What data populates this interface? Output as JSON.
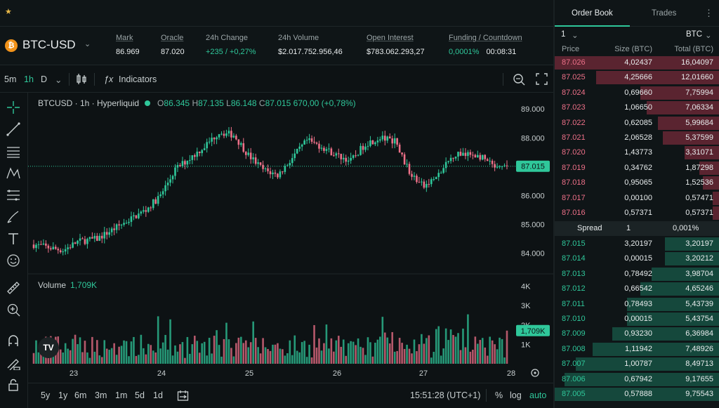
{
  "topbar": {
    "star_icon": "star-icon"
  },
  "market": {
    "coin_glyph": "₿",
    "pair": "BTC-USD",
    "stats": [
      {
        "label": "Mark",
        "value": "86.969",
        "underline": true,
        "green": false
      },
      {
        "label": "Oracle",
        "value": "87.020",
        "underline": true,
        "green": false
      },
      {
        "label": "24h Change",
        "value": "+235 / +0,27%",
        "underline": false,
        "green": true
      },
      {
        "label": "24h Volume",
        "value": "$2.017.752.956,46",
        "underline": false,
        "green": false
      },
      {
        "label": "Open Interest",
        "value": "$783.062.293,27",
        "underline": true,
        "green": false
      },
      {
        "label": "Funding / Countdown",
        "value": "0,0001%",
        "value2": "00:08:31",
        "underline": true,
        "green": true
      }
    ]
  },
  "toolbar": {
    "intervals": [
      "5m",
      "1h",
      "D"
    ],
    "active_interval": "1h",
    "indicators_label": "Indicators",
    "fx_glyph": "ƒx"
  },
  "chart": {
    "legend_symbol": "BTCUSD · 1h · Hyperliquid",
    "ohlc": {
      "o_label": "O",
      "o": "86.345",
      "h_label": "H",
      "h": "87.135",
      "l_label": "L",
      "l": "86.148",
      "c_label": "C",
      "c": "87.015",
      "chg": "670,00 (+0,78%)"
    },
    "volume_label": "Volume",
    "volume_value": "1,709K",
    "tv_logo": "TV"
  },
  "chart_data": {
    "type": "candlestick",
    "price_ticks": [
      84000,
      85000,
      86000,
      87000,
      88000,
      89000
    ],
    "price_tick_labels": [
      "84.000",
      "85.000",
      "86.000",
      "87.000",
      "88.000",
      "89.000"
    ],
    "last_price_label": "87.015",
    "last_price": 87015,
    "volume_ticks": [
      1000,
      2000,
      3000,
      4000
    ],
    "volume_tick_labels": [
      "1K",
      "2K",
      "3K",
      "4K"
    ],
    "last_volume_label": "1,709K",
    "last_volume": 1709,
    "x_tick_labels": [
      "23",
      "24",
      "25",
      "26",
      "27",
      "28"
    ],
    "ylim": [
      83600,
      89200
    ],
    "vol_max": 4200
  },
  "bottombar": {
    "ranges": [
      "5y",
      "1y",
      "6m",
      "3m",
      "1m",
      "5d",
      "1d"
    ],
    "time": "15:51:28 (UTC+1)",
    "pct": "%",
    "log": "log",
    "auto": "auto"
  },
  "book": {
    "tabs": [
      "Order Book",
      "Trades"
    ],
    "group": "1",
    "unit": "BTC",
    "headers": [
      "Price",
      "Size (BTC)",
      "Total (BTC)"
    ],
    "asks": [
      {
        "price": "87.026",
        "size": "4,02437",
        "total": "16,04097",
        "depth": 1.0
      },
      {
        "price": "87.025",
        "size": "4,25666",
        "total": "12,01660",
        "depth": 0.75
      },
      {
        "price": "87.024",
        "size": "0,69660",
        "total": "7,75994",
        "depth": 0.48
      },
      {
        "price": "87.023",
        "size": "1,06650",
        "total": "7,06334",
        "depth": 0.44
      },
      {
        "price": "87.022",
        "size": "0,62085",
        "total": "5,99684",
        "depth": 0.37
      },
      {
        "price": "87.021",
        "size": "2,06528",
        "total": "5,37599",
        "depth": 0.34
      },
      {
        "price": "87.020",
        "size": "1,43773",
        "total": "3,31071",
        "depth": 0.21
      },
      {
        "price": "87.019",
        "size": "0,34762",
        "total": "1,87298",
        "depth": 0.12
      },
      {
        "price": "87.018",
        "size": "0,95065",
        "total": "1,52536",
        "depth": 0.1
      },
      {
        "price": "87.017",
        "size": "0,00100",
        "total": "0,57471",
        "depth": 0.04
      },
      {
        "price": "87.016",
        "size": "0,57371",
        "total": "0,57371",
        "depth": 0.04
      }
    ],
    "spread": {
      "label": "Spread",
      "value": "1",
      "pct": "0,001%"
    },
    "bids": [
      {
        "price": "87.015",
        "size": "3,20197",
        "total": "3,20197",
        "depth": 0.33
      },
      {
        "price": "87.014",
        "size": "0,00015",
        "total": "3,20212",
        "depth": 0.33
      },
      {
        "price": "87.013",
        "size": "0,78492",
        "total": "3,98704",
        "depth": 0.41
      },
      {
        "price": "87.012",
        "size": "0,66542",
        "total": "4,65246",
        "depth": 0.48
      },
      {
        "price": "87.011",
        "size": "0,78493",
        "total": "5,43739",
        "depth": 0.56
      },
      {
        "price": "87.010",
        "size": "0,00015",
        "total": "5,43754",
        "depth": 0.56
      },
      {
        "price": "87.009",
        "size": "0,93230",
        "total": "6,36984",
        "depth": 0.65
      },
      {
        "price": "87.008",
        "size": "1,11942",
        "total": "7,48926",
        "depth": 0.77
      },
      {
        "price": "87.007",
        "size": "1,00787",
        "total": "8,49713",
        "depth": 0.87
      },
      {
        "price": "87.006",
        "size": "0,67942",
        "total": "9,17655",
        "depth": 0.94
      },
      {
        "price": "87.005",
        "size": "0,57888",
        "total": "9,75543",
        "depth": 1.0
      }
    ]
  },
  "colors": {
    "up": "#2fc79a",
    "down": "#ed7088",
    "ask_bg": "#5a2430",
    "bid_bg": "#15483c"
  }
}
